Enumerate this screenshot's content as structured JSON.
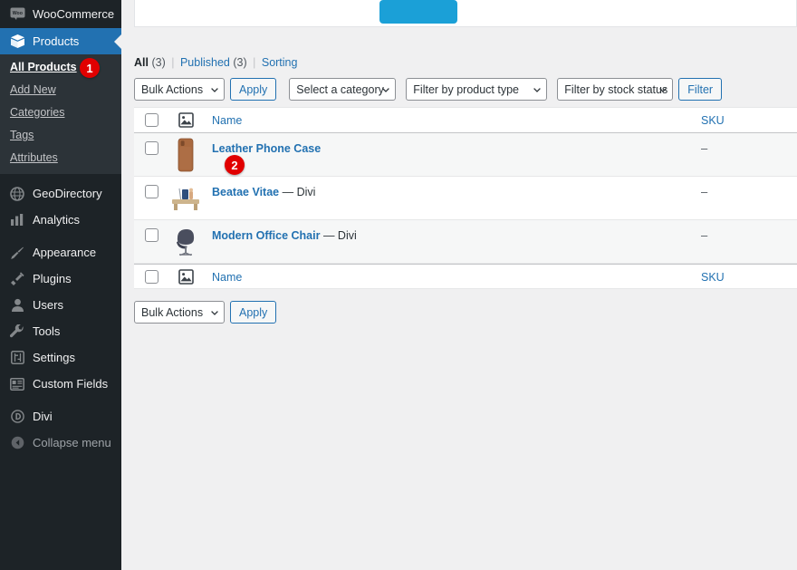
{
  "sidebar": {
    "items": [
      {
        "label": "WooCommerce",
        "icon": "woocommerce-icon",
        "name": "sidebar-item-woocommerce",
        "current": false
      },
      {
        "label": "Products",
        "icon": "products-box-icon",
        "name": "sidebar-item-products",
        "current": true
      },
      {
        "label": "GeoDirectory",
        "icon": "globe-icon",
        "name": "sidebar-item-geodirectory",
        "current": false
      },
      {
        "label": "Analytics",
        "icon": "chart-bars-icon",
        "name": "sidebar-item-analytics",
        "current": false
      },
      {
        "label": "Appearance",
        "icon": "paintbrush-icon",
        "name": "sidebar-item-appearance",
        "current": false
      },
      {
        "label": "Plugins",
        "icon": "plug-icon",
        "name": "sidebar-item-plugins",
        "current": false
      },
      {
        "label": "Users",
        "icon": "user-icon",
        "name": "sidebar-item-users",
        "current": false
      },
      {
        "label": "Tools",
        "icon": "wrench-icon",
        "name": "sidebar-item-tools",
        "current": false
      },
      {
        "label": "Settings",
        "icon": "sliders-icon",
        "name": "sidebar-item-settings",
        "current": false
      },
      {
        "label": "Custom Fields",
        "icon": "custom-fields-icon",
        "name": "sidebar-item-custom-fields",
        "current": false
      },
      {
        "label": "Divi",
        "icon": "divi-icon",
        "name": "sidebar-item-divi",
        "current": false
      },
      {
        "label": "Collapse menu",
        "icon": "collapse-arrow-icon",
        "name": "sidebar-item-collapse-menu",
        "current": false
      }
    ],
    "submenu": [
      {
        "label": "All Products",
        "current": true
      },
      {
        "label": "Add New",
        "current": false
      },
      {
        "label": "Categories",
        "current": false
      },
      {
        "label": "Tags",
        "current": false
      },
      {
        "label": "Attributes",
        "current": false
      }
    ]
  },
  "markers": [
    {
      "number": "1",
      "color": "#e10000"
    },
    {
      "number": "2",
      "color": "#e10000"
    }
  ],
  "views": {
    "all_label": "All",
    "all_count": "(3)",
    "published_label": "Published",
    "published_count": "(3)",
    "sorting_label": "Sorting",
    "separator": "|"
  },
  "tablenav_top": {
    "bulk_actions_label": "Bulk Actions",
    "apply_label": "Apply",
    "category_label": "Select a category",
    "product_type_label": "Filter by product type",
    "stock_status_label": "Filter by stock status",
    "filter_label": "Filter"
  },
  "tablenav_bottom": {
    "bulk_actions_label": "Bulk Actions",
    "apply_label": "Apply"
  },
  "table": {
    "columns": {
      "thumb": "image-placeholder-icon",
      "name": "Name",
      "sku": "SKU"
    },
    "rows": [
      {
        "name": "Leather Phone Case",
        "suffix": "",
        "sku": "–",
        "thumb": "leather-phone-case-thumbnail",
        "alt": true
      },
      {
        "name": "Beatae Vitae",
        "suffix": " — Divi",
        "sku": "–",
        "thumb": "wooden-table-thumbnail",
        "alt": false
      },
      {
        "name": "Modern Office Chair",
        "suffix": " — Divi",
        "sku": "–",
        "thumb": "office-chair-thumbnail",
        "alt": true
      }
    ]
  },
  "top_panel": {
    "button_color": "#1ba0d7",
    "illustration": "desk-person-line-art"
  },
  "colors": {
    "sidebar_bg": "#1d2327",
    "submenu_bg": "#2c3338",
    "current_blue": "#2271b1",
    "link_blue": "#2271b1",
    "marker_red": "#e10000",
    "page_bg": "#f0f0f1"
  }
}
